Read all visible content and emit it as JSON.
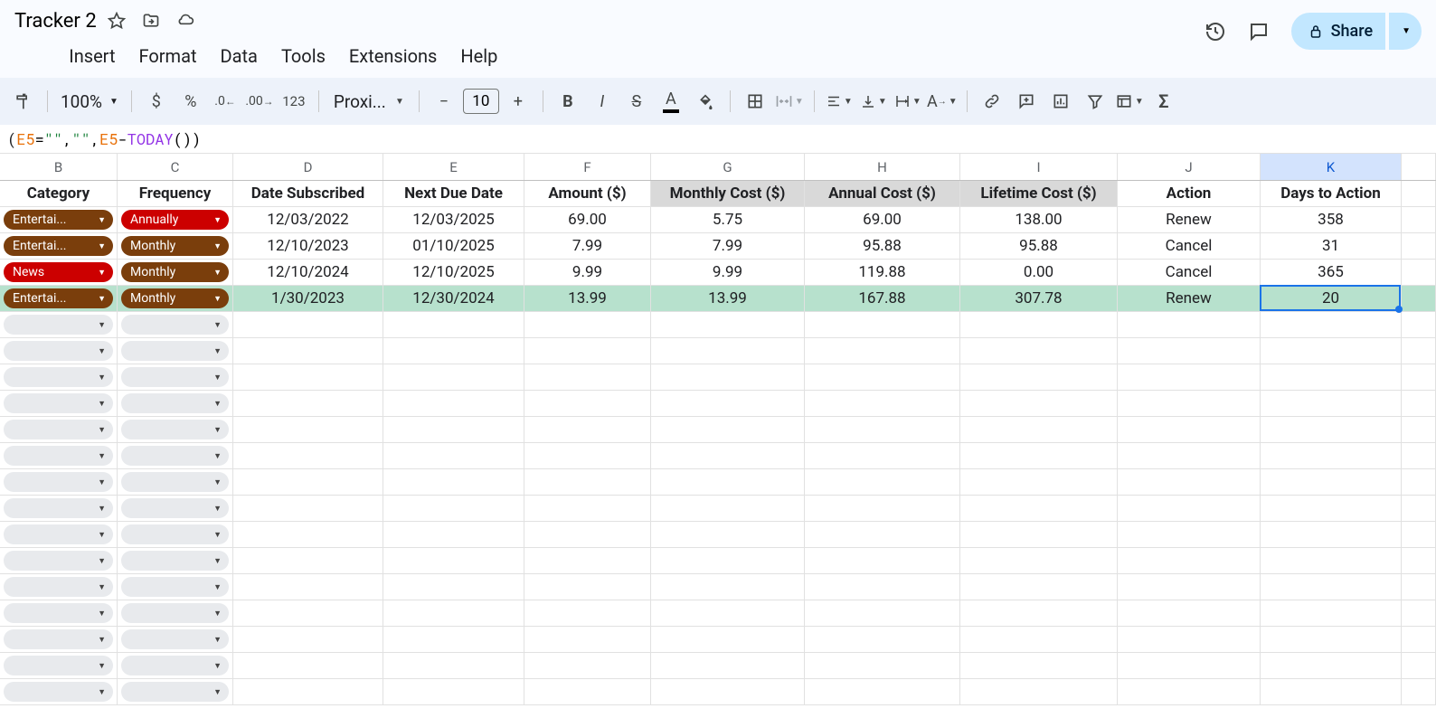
{
  "doc_title": "Tracker 2",
  "menus": [
    "Insert",
    "Format",
    "Data",
    "Tools",
    "Extensions",
    "Help"
  ],
  "share_label": "Share",
  "toolbar": {
    "zoom": "100%",
    "font": "Proxi...",
    "font_size": "10"
  },
  "formula": {
    "part_cell1": "E5",
    "part_eq": "=",
    "part_str1": "\"\"",
    "part_comma1": ",",
    "part_str2": "\"\"",
    "part_comma2": ", ",
    "part_cell2": "E5",
    "part_minus": "-",
    "part_func": "TODAY",
    "part_paren": "())"
  },
  "columns": [
    "B",
    "C",
    "D",
    "E",
    "F",
    "G",
    "H",
    "I",
    "J",
    "K"
  ],
  "selected_col": "K",
  "headers": {
    "B": "Category",
    "C": "Frequency",
    "D": "Date Subscribed",
    "E": "Next Due Date",
    "F": "Amount ($)",
    "G": "Monthly Cost ($)",
    "H": "Annual Cost ($)",
    "I": "Lifetime Cost ($)",
    "J": "Action",
    "K": "Days to Action"
  },
  "rows": [
    {
      "cat": "Entertai...",
      "cat_color": "brown",
      "freq": "Annually",
      "freq_color": "red",
      "d": "12/03/2022",
      "e": "12/03/2025",
      "f": "69.00",
      "g": "5.75",
      "h": "69.00",
      "i": "138.00",
      "j": "Renew",
      "k": "358",
      "hl": false
    },
    {
      "cat": "Entertai...",
      "cat_color": "brown",
      "freq": "Monthly",
      "freq_color": "brown",
      "d": "12/10/2023",
      "e": "01/10/2025",
      "f": "7.99",
      "g": "7.99",
      "h": "95.88",
      "i": "95.88",
      "j": "Cancel",
      "k": "31",
      "hl": false
    },
    {
      "cat": "News",
      "cat_color": "red",
      "freq": "Monthly",
      "freq_color": "brown",
      "d": "12/10/2024",
      "e": "12/10/2025",
      "f": "9.99",
      "g": "9.99",
      "h": "119.88",
      "i": "0.00",
      "j": "Cancel",
      "k": "365",
      "hl": false
    },
    {
      "cat": "Entertai...",
      "cat_color": "brown",
      "freq": "Monthly",
      "freq_color": "brown",
      "d": "1/30/2023",
      "e": "12/30/2024",
      "f": "13.99",
      "g": "13.99",
      "h": "167.88",
      "i": "307.78",
      "j": "Renew",
      "k": "20",
      "hl": true
    }
  ],
  "empty_row_count": 15,
  "selection": {
    "col": "K",
    "data_row_index": 3
  }
}
